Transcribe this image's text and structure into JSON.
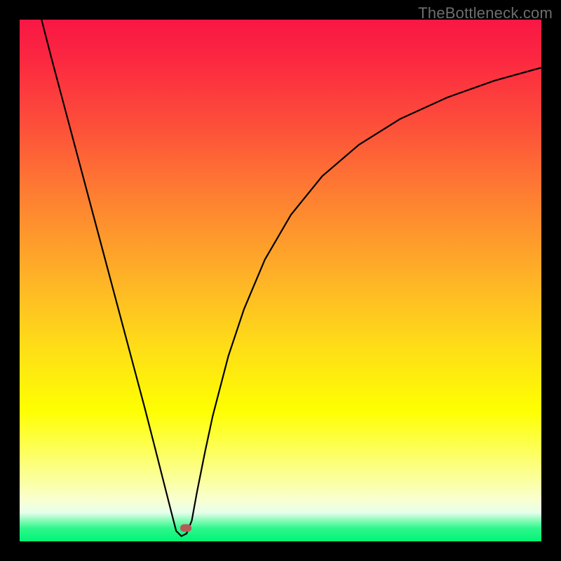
{
  "watermark": {
    "text": "TheBottleneck.com"
  },
  "chart_data": {
    "type": "line",
    "title": "",
    "xlabel": "",
    "ylabel": "",
    "x_range": [
      0,
      1
    ],
    "y_range": [
      0,
      1
    ],
    "grid": false,
    "legend": false,
    "background": {
      "gradient_direction": "vertical",
      "stops": [
        {
          "offset": 0.0,
          "color": "#f91744"
        },
        {
          "offset": 0.07,
          "color": "#fb2641"
        },
        {
          "offset": 0.2,
          "color": "#fd4e3a"
        },
        {
          "offset": 0.35,
          "color": "#fe8331"
        },
        {
          "offset": 0.5,
          "color": "#feb426"
        },
        {
          "offset": 0.63,
          "color": "#fede17"
        },
        {
          "offset": 0.75,
          "color": "#feff01"
        },
        {
          "offset": 0.82,
          "color": "#fdff53"
        },
        {
          "offset": 0.88,
          "color": "#fbff9c"
        },
        {
          "offset": 0.92,
          "color": "#f9ffd0"
        },
        {
          "offset": 0.945,
          "color": "#e7ffec"
        },
        {
          "offset": 0.96,
          "color": "#86fcb7"
        },
        {
          "offset": 0.975,
          "color": "#2ef78c"
        },
        {
          "offset": 1.0,
          "color": "#01f376"
        }
      ]
    },
    "series": [
      {
        "name": "bottleneck-curve",
        "color": "#000000",
        "stroke_width": 2.2,
        "x": [
          0.042,
          0.06,
          0.08,
          0.1,
          0.12,
          0.14,
          0.16,
          0.18,
          0.2,
          0.22,
          0.24,
          0.26,
          0.275,
          0.29,
          0.3,
          0.31,
          0.32,
          0.33,
          0.34,
          0.355,
          0.37,
          0.4,
          0.43,
          0.47,
          0.52,
          0.58,
          0.65,
          0.73,
          0.82,
          0.91,
          1.0
        ],
        "y": [
          1.0,
          0.93,
          0.855,
          0.78,
          0.705,
          0.63,
          0.555,
          0.48,
          0.405,
          0.33,
          0.255,
          0.177,
          0.118,
          0.059,
          0.02,
          0.01,
          0.015,
          0.04,
          0.095,
          0.17,
          0.24,
          0.355,
          0.445,
          0.54,
          0.626,
          0.7,
          0.76,
          0.81,
          0.851,
          0.883,
          0.908
        ]
      }
    ],
    "marker": {
      "x": 0.318,
      "y": 0.025,
      "color": "#b85959"
    }
  }
}
